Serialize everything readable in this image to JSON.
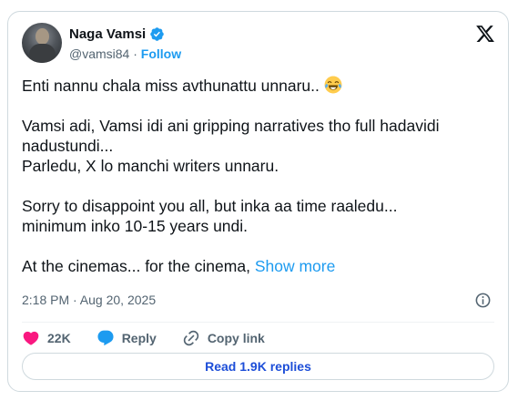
{
  "author": {
    "name": "Naga Vamsi",
    "handle": "@vamsi84",
    "separator": "·",
    "follow_label": "Follow"
  },
  "tweet": {
    "lines": [
      "Enti nannu chala miss avthunattu unnaru..",
      "Vamsi adi, Vamsi idi ani gripping narratives tho full hadavidi nadustundi...",
      "Parledu, X lo manchi writers unnaru.",
      "Sorry to disappoint you all, but inka aa time raaledu...",
      "minimum inko 10-15 years undi.",
      "At the cinemas... for the cinema,"
    ],
    "show_more": "Show more",
    "timestamp": "2:18 PM · Aug 20, 2025"
  },
  "actions": {
    "likes": "22K",
    "reply_label": "Reply",
    "copy_link_label": "Copy link"
  },
  "read_replies_label": "Read 1.9K replies",
  "colors": {
    "accent": "#1d9bf0",
    "like": "#f91880",
    "text": "#0f1419",
    "muted": "#536471"
  },
  "icons": [
    "verified-badge-icon",
    "x-logo-icon",
    "joy-emoji-icon",
    "info-icon",
    "heart-icon",
    "reply-bubble-icon",
    "link-icon"
  ]
}
